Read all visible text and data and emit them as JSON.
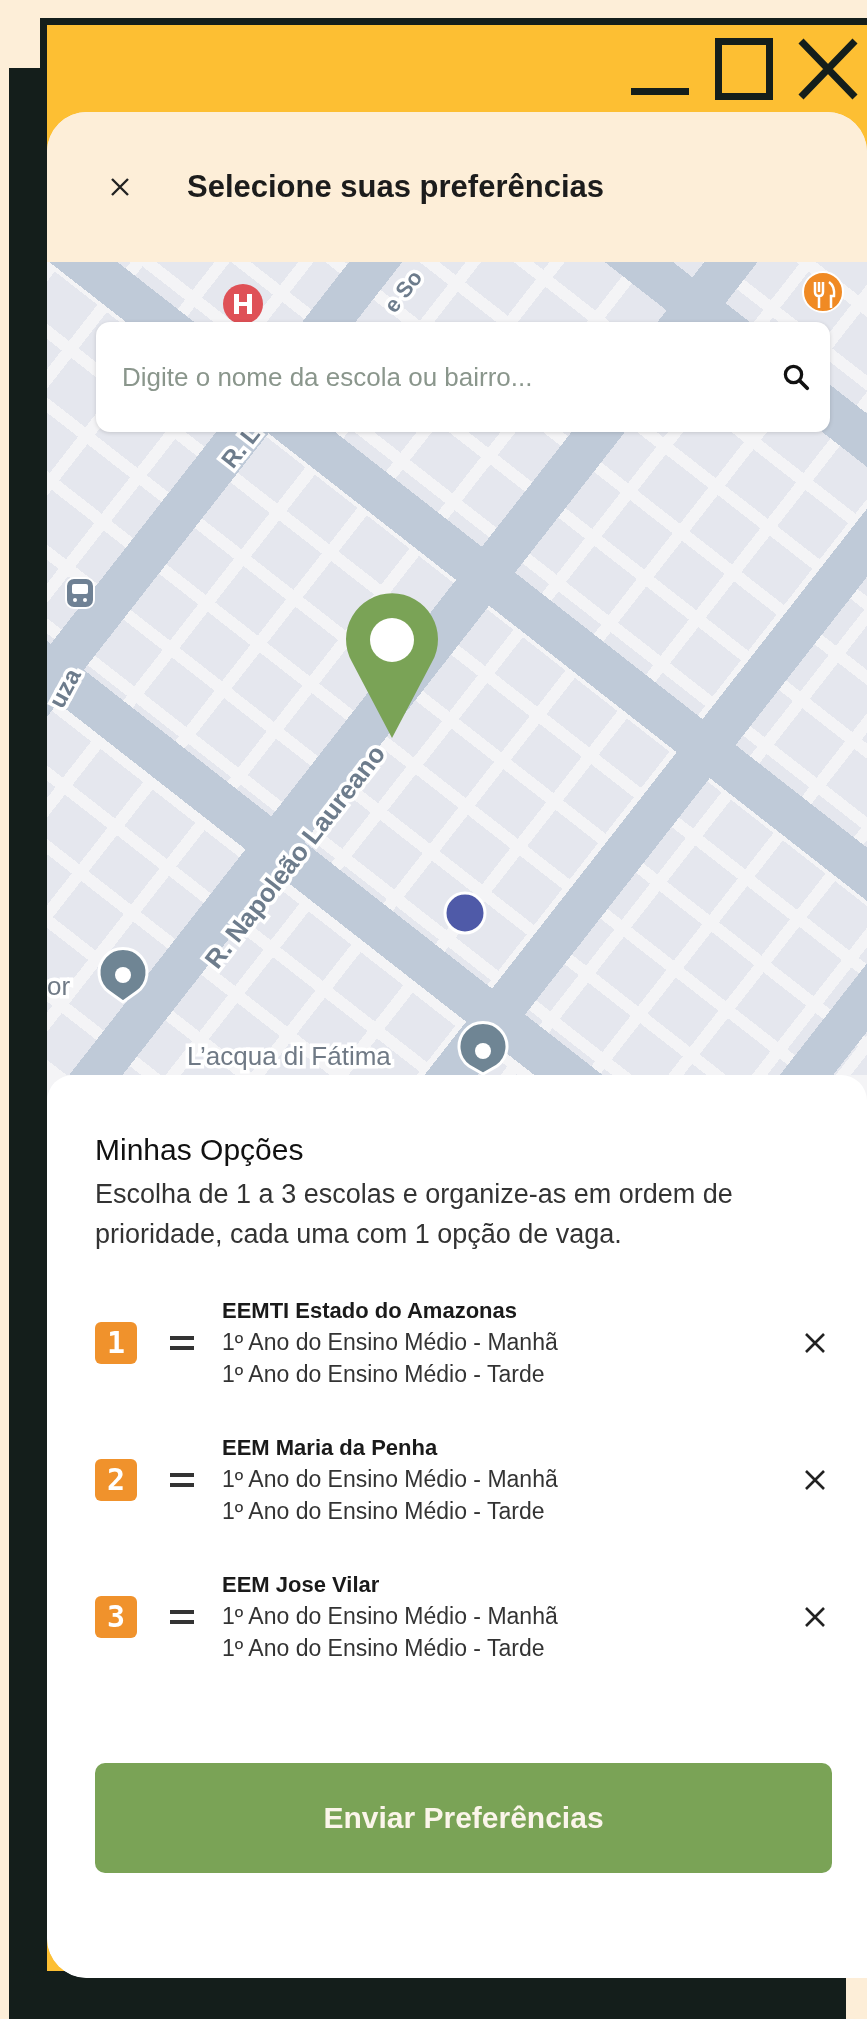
{
  "header": {
    "title": "Selecione suas preferências"
  },
  "search": {
    "placeholder": "Digite o nome da escola ou bairro..."
  },
  "map": {
    "labels": [
      "e So",
      "R. L",
      "uza",
      "R. Napoleão Laureano",
      "or",
      "L’acqua di Fátima"
    ]
  },
  "options": {
    "title": "Minhas Opções",
    "description": "Escolha de 1 a 3 escolas e organize-as em ordem de prioridade, cada uma com 1 opção de vaga.",
    "items": [
      {
        "number": "1",
        "school": "EEMTI Estado do Amazonas",
        "shifts": [
          "1º Ano do Ensino Médio - Manhã",
          "1º Ano do Ensino Médio - Tarde"
        ]
      },
      {
        "number": "2",
        "school": "EEM Maria da Penha",
        "shifts": [
          "1º Ano do Ensino Médio - Manhã",
          "1º Ano do Ensino Médio - Tarde"
        ]
      },
      {
        "number": "3",
        "school": "EEM Jose Vilar",
        "shifts": [
          "1º Ano do Ensino Médio - Manhã",
          "1º Ano do Ensino Médio - Tarde"
        ]
      }
    ]
  },
  "submit_button": "Enviar Preferências"
}
